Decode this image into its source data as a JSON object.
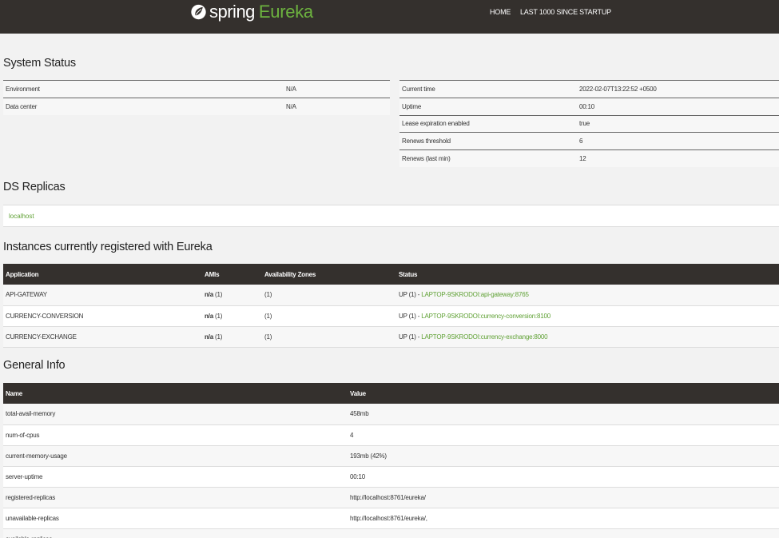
{
  "nav": {
    "brand_spring": "spring",
    "brand_eureka": "Eureka",
    "home": "HOME",
    "last_1000": "LAST 1000 SINCE STARTUP"
  },
  "system_status": {
    "title": "System Status",
    "left": [
      {
        "label": "Environment",
        "value": "N/A"
      },
      {
        "label": "Data center",
        "value": "N/A"
      }
    ],
    "right": [
      {
        "label": "Current time",
        "value": "2022-02-07T13:22:52 +0500"
      },
      {
        "label": "Uptime",
        "value": "00:10"
      },
      {
        "label": "Lease expiration enabled",
        "value": "true"
      },
      {
        "label": "Renews threshold",
        "value": "6"
      },
      {
        "label": "Renews (last min)",
        "value": "12"
      }
    ]
  },
  "ds_replicas": {
    "title": "DS Replicas",
    "host": "localhost"
  },
  "instances": {
    "title": "Instances currently registered with Eureka",
    "headers": [
      "Application",
      "AMIs",
      "Availability Zones",
      "Status"
    ],
    "rows": [
      {
        "app": "API-GATEWAY",
        "ami_bold": "n/a",
        "ami_count": " (1)",
        "zones": "(1)",
        "status": "UP (1) - ",
        "instance": "LAPTOP-9SKRODOI:api-gateway:8765"
      },
      {
        "app": "CURRENCY-CONVERSION",
        "ami_bold": "n/a",
        "ami_count": " (1)",
        "zones": "(1)",
        "status": "UP (1) - ",
        "instance": "LAPTOP-9SKRODOI:currency-conversion:8100"
      },
      {
        "app": "CURRENCY-EXCHANGE",
        "ami_bold": "n/a",
        "ami_count": " (1)",
        "zones": "(1)",
        "status": "UP (1) - ",
        "instance": "LAPTOP-9SKRODOI:currency-exchange:8000"
      }
    ]
  },
  "general_info": {
    "title": "General Info",
    "headers": [
      "Name",
      "Value"
    ],
    "rows": [
      {
        "name": "total-avail-memory",
        "value": "458mb"
      },
      {
        "name": "num-of-cpus",
        "value": "4"
      },
      {
        "name": "current-memory-usage",
        "value": "193mb (42%)"
      },
      {
        "name": "server-uptime",
        "value": "00:10"
      },
      {
        "name": "registered-replicas",
        "value": "http://localhost:8761/eureka/"
      },
      {
        "name": "unavailable-replicas",
        "value": "http://localhost:8761/eureka/,"
      },
      {
        "name": "available-replicas",
        "value": ""
      }
    ]
  },
  "colors": {
    "navbar": "#34302d",
    "accent_green": "#6db33f",
    "link_green": "#5fa134",
    "page_bg": "#f2f2f2"
  },
  "icons": {
    "brand": "spring-leaf-icon"
  }
}
